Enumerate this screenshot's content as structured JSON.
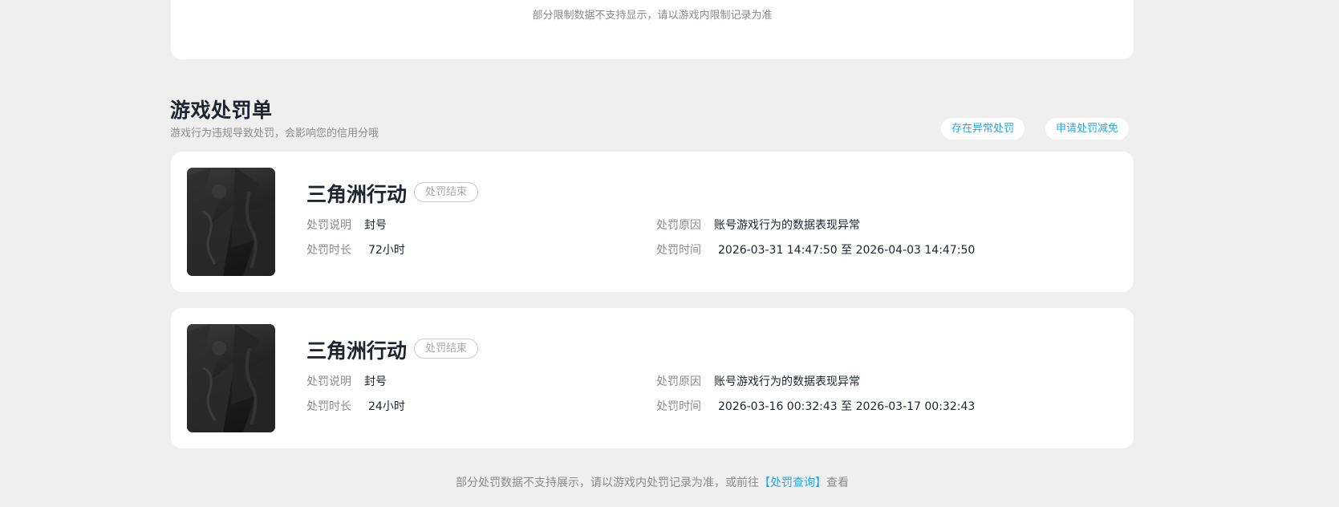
{
  "top_card": {
    "note": "部分限制数据不支持显示，请以游戏内限制记录为准"
  },
  "section": {
    "title": "游戏处罚单",
    "subtitle": "游戏行为违规导致处罚，会影响您的信用分哦",
    "abnormal_button": "存在异常处罚",
    "appeal_button": "申请处罚减免"
  },
  "labels": {
    "description": "处罚说明",
    "duration": "处罚时长",
    "reason": "处罚原因",
    "time": "处罚时间"
  },
  "records": [
    {
      "game_name": "三角洲行动",
      "status": "处罚结束",
      "description": "封号",
      "duration": "72小时",
      "reason": "账号游戏行为的数据表现异常",
      "time": "2026-03-31 14:47:50 至 2026-04-03 14:47:50"
    },
    {
      "game_name": "三角洲行动",
      "status": "处罚结束",
      "description": "封号",
      "duration": "24小时",
      "reason": "账号游戏行为的数据表现异常",
      "time": "2026-03-16 00:32:43 至 2026-03-17 00:32:43"
    }
  ],
  "footer": {
    "text_before": "部分处罚数据不支持展示，请以游戏内处罚记录为准，或前往",
    "link": "【处罚查询】",
    "text_after": "查看"
  },
  "colors": {
    "background": "#efefef",
    "card": "#ffffff",
    "accent": "#25a6e6",
    "title": "#1e2430",
    "muted": "#8c8c8c"
  },
  "icons": {
    "game_cover": "game-cover-image"
  }
}
